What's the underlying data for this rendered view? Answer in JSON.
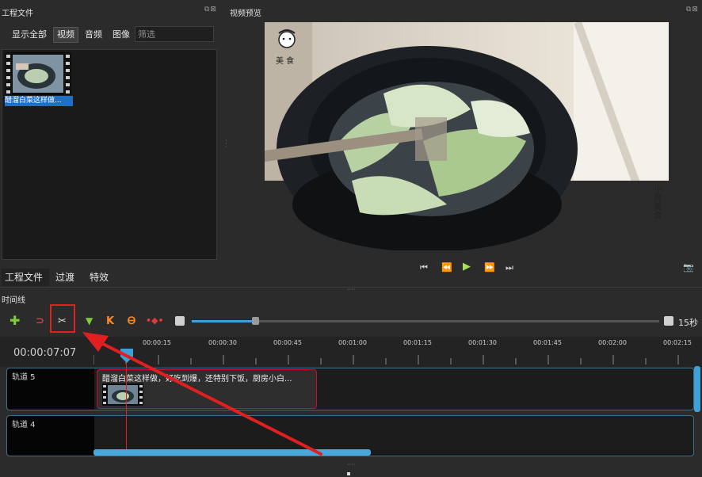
{
  "project_panel": {
    "title": "工程文件",
    "filters": [
      "显示全部",
      "视频",
      "音频",
      "图像"
    ],
    "filter_placeholder": "筛选",
    "file_item_label": "醋溜白菜这样做..."
  },
  "preview_panel": {
    "title": "视频预览",
    "watermark_top": "美 食",
    "watermark_side": "小房美食"
  },
  "bottom_tabs": [
    "工程文件",
    "过渡",
    "特效"
  ],
  "timeline": {
    "title": "时间线",
    "current_time": "00:00:07:07",
    "zoom_label": "15秒",
    "ruler": [
      "00:00:15",
      "00:00:30",
      "00:00:45",
      "00:01:00",
      "00:01:15",
      "00:01:30",
      "00:01:45",
      "00:02:00",
      "00:02:15"
    ],
    "tracks": [
      {
        "name": "轨道 5",
        "clip_title": "醋溜白菜这样做，好吃到爆，还特别下饭，厨房小白..."
      },
      {
        "name": "轨道 4"
      }
    ]
  },
  "icons": {
    "add": "plus-icon",
    "snap": "magnet-icon",
    "razor": "scissors-icon",
    "marker": "marker-icon",
    "prev_marker": "jump-start-icon",
    "next_marker": "jump-end-icon",
    "center": "center-playhead-icon"
  },
  "colors": {
    "highlight": "#e02020",
    "accent": "#3fa0d8",
    "clip_border": "#c8102e"
  }
}
